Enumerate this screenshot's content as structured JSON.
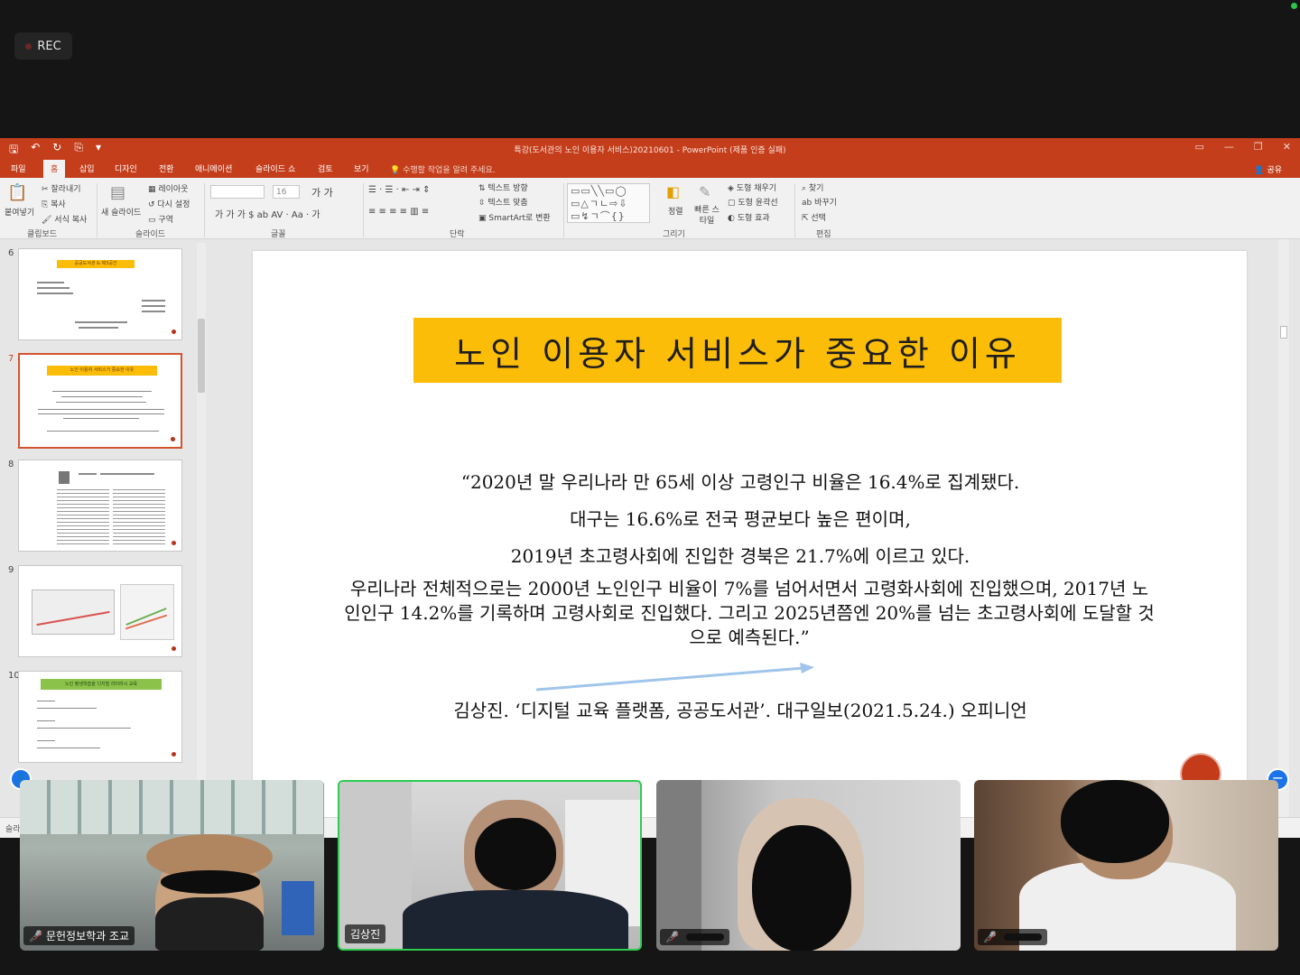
{
  "meeting": {
    "rec_label": "REC"
  },
  "ppt": {
    "window_title": "특강(도서관의 노인 이용자 서비스)20210601 - PowerPoint (제품 인증 실패)",
    "tabs": [
      "파일",
      "홈",
      "삽입",
      "디자인",
      "전환",
      "애니메이션",
      "슬라이드 쇼",
      "검토",
      "보기"
    ],
    "active_tab": "홈",
    "tell_me": "수행할 작업을 알려 주세요.",
    "share": "공유",
    "ribbon": {
      "paste": "붙여넣기",
      "cut": "잘라내기",
      "copy": "복사",
      "format_painter": "서식 복사",
      "clipboard_label": "클립보드",
      "new_slide": "새 슬라이드",
      "layout": "레이아웃",
      "reset": "다시 설정",
      "section": "구역",
      "slides_label": "슬라이드",
      "font_size": "16",
      "font_label": "글꼴",
      "text_direction": "텍스트 방향",
      "align_text": "텍스트 맞춤",
      "smartart": "SmartArt로 변환",
      "paragraph_label": "단락",
      "arrange": "정렬",
      "quick_styles": "빠른 스타일",
      "shape_fill": "도형 채우기",
      "shape_outline": "도형 윤곽선",
      "shape_effects": "도형 효과",
      "drawing_label": "그리기",
      "find": "찾기",
      "replace": "바꾸기",
      "select": "선택",
      "editing_label": "편집"
    },
    "thumbnails": [
      {
        "num": "6",
        "title": "공공도서관 & 제3공간"
      },
      {
        "num": "7",
        "title": "노인 이용자 서비스가 중요한 이유"
      },
      {
        "num": "8",
        "title": ""
      },
      {
        "num": "9",
        "title": ""
      },
      {
        "num": "10",
        "title": "노인 평생학습을 디지털 리터러시 교육"
      }
    ],
    "status_left": "슬라이",
    "slide": {
      "title": "노인 이용자 서비스가 중요한 이유",
      "line1": "“2020년 말 우리나라 만 65세 이상 고령인구 비율은 16.4%로 집계됐다.",
      "line2": "대구는 16.6%로 전국 평균보다 높은 편이며,",
      "line3": "2019년 초고령사회에 진입한 경북은 21.7%에 이르고 있다.",
      "line4": "우리나라 전체적으로는 2000년 노인인구 비율이 7%를 넘어서면서 고령화사회에 진입했으며, 2017년 노인인구 14.2%를 기록하며 고령사회로 진입했다. 그리고 2025년쯤엔 20%를 넘는 초고령사회에 도달할 것으로 예측된다.”",
      "source": "김상진. ‘디지털 교육 플랫폼, 공공도서관’. 대구일보(2021.5.24.) 오피니언"
    }
  },
  "participants": [
    {
      "name": "문헌정보학과 조교",
      "muted": true
    },
    {
      "name": "김상진",
      "muted": false
    },
    {
      "name": "",
      "muted": true
    },
    {
      "name": "",
      "muted": true
    }
  ],
  "colors": {
    "ppt_accent": "#c43e1c",
    "title_fill": "#fbbd08",
    "active_speaker": "#2ecc4f"
  }
}
